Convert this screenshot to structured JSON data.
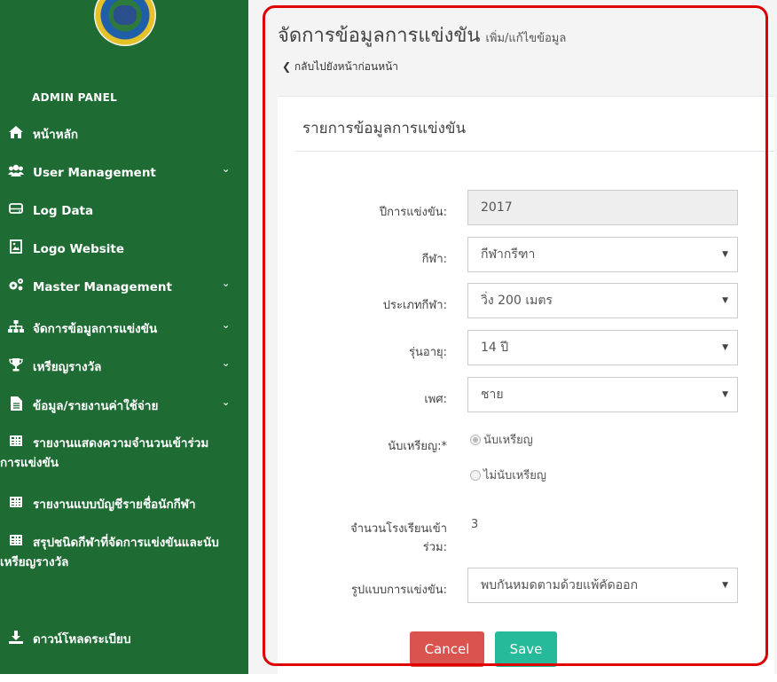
{
  "sidebar": {
    "panel_title": "ADMIN PANEL",
    "items": [
      {
        "label": "หน้าหลัก",
        "icon": "home-icon"
      },
      {
        "label": "User Management",
        "icon": "users-icon"
      },
      {
        "label": "Log Data",
        "icon": "hdd-icon"
      },
      {
        "label": "Logo Website",
        "icon": "image-file-icon"
      },
      {
        "label": "Master Management",
        "icon": "cogs-icon"
      },
      {
        "label": "จัดการข้อมูลการแข่งขัน",
        "icon": "sitemap-icon"
      },
      {
        "label": "เหรียญรางวัล",
        "icon": "trophy-icon"
      },
      {
        "label": "ข้อมูล/รายงานค่าใช้จ่าย",
        "icon": "file-icon"
      },
      {
        "label": "รายงานแสดงความจำนวนเข้าร่วมการแข่งขัน",
        "icon": "table-icon"
      },
      {
        "label": "รายงานแบบบัญชีรายชื่อนักกีฬา",
        "icon": "table-icon"
      },
      {
        "label": "สรุปชนิดกีฬาที่จัดการแข่งขันและนับเหรียญรางวัล",
        "icon": "table-icon"
      },
      {
        "label": "ดาวน์โหลดระเบียบ",
        "icon": "download-icon"
      }
    ]
  },
  "header": {
    "title": "จัดการข้อมูลการแข่งขัน",
    "subtitle": "เพิ่ม/แก้ไขข้อมูล",
    "back_link": "กลับไปยังหน้าก่อนหน้า"
  },
  "card": {
    "title": "รายการข้อมูลการแข่งขัน"
  },
  "form": {
    "year_label": "ปีการแข่งขัน:",
    "year_value": "2017",
    "sport_label": "กีฬา:",
    "sport_value": "กีฬากรีฑา",
    "sport_type_label": "ประเภทกีฬา:",
    "sport_type_value": "วิ่ง 200 เมตร",
    "age_label": "รุ่นอายุ:",
    "age_value": "14 ปี",
    "gender_label": "เพศ:",
    "gender_value": "ชาย",
    "medal_label": "นับเหรียญ:*",
    "medal_options": [
      "นับเหรียญ",
      "ไม่นับเหรียญ"
    ],
    "medal_selected": "นับเหรียญ",
    "schools_label_1": "จำนวนโรงเรียนเข้า",
    "schools_label_2": "ร่วม:",
    "schools_value": "3",
    "format_label": "รูปแบบการแข่งขัน:",
    "format_value": "พบกันหมดตามด้วยแพ้คัดออก"
  },
  "buttons": {
    "cancel": "Cancel",
    "save": "Save"
  },
  "colors": {
    "sidebar": "#1e6b33",
    "cancel": "#d9534f",
    "save": "#26b99a",
    "highlight": "#e00000"
  }
}
